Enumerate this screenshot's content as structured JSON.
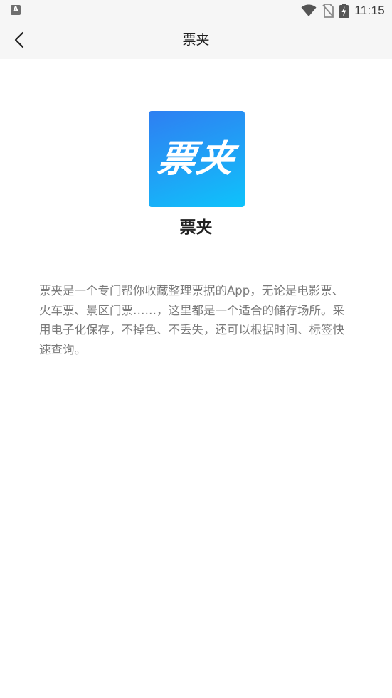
{
  "status_bar": {
    "app_icon_letter": "A",
    "time": "11:15"
  },
  "nav": {
    "title": "票夹"
  },
  "app": {
    "logo_text": "票夹",
    "name": "票夹",
    "description": "票夹是一个专门帮你收藏整理票据的App，无论是电影票、火车票、景区门票……，这里都是一个适合的储存场所。采用电子化保存，不掉色、不丢失，还可以根据时间、标签快速查询。"
  },
  "colors": {
    "logo_gradient_start": "#2e7ff2",
    "logo_gradient_end": "#0ec3fb",
    "nav_background": "#f6f6f6"
  }
}
